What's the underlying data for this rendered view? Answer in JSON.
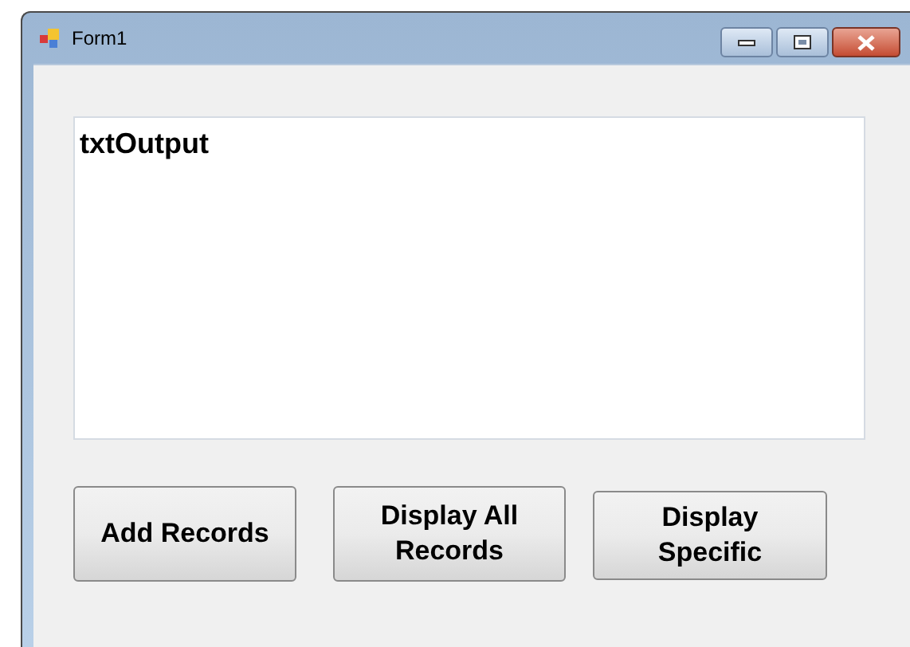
{
  "window": {
    "title": "Form1"
  },
  "output_box": {
    "value": "txtOutput"
  },
  "buttons": [
    {
      "label": "Add Records"
    },
    {
      "label": "Display All Records"
    },
    {
      "label": "Display Specific"
    }
  ]
}
